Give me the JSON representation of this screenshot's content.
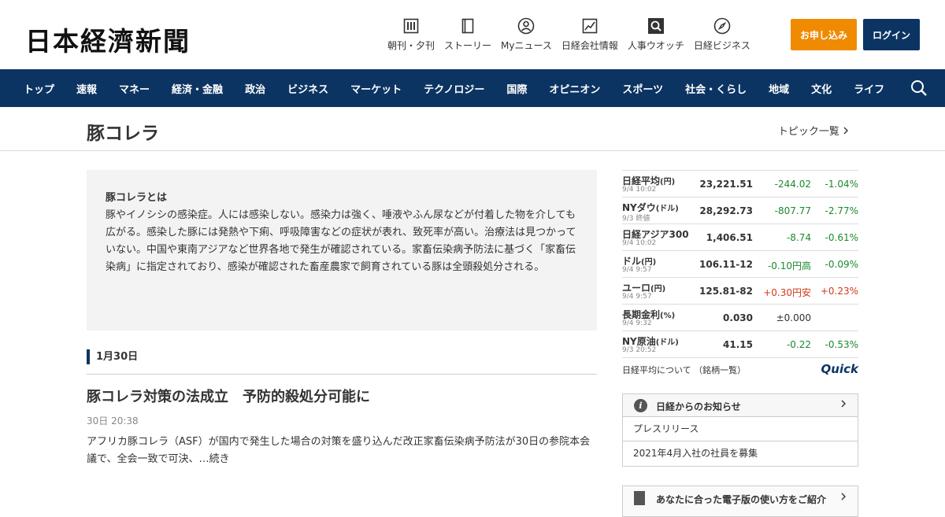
{
  "brand": {
    "logo_text": "日本経濟新聞",
    "apply_label": "お申し込み",
    "login_label": "ログイン"
  },
  "toolbar": [
    {
      "label": "朝刊・夕刊",
      "icon": "newspaper-icon"
    },
    {
      "label": "ストーリー",
      "icon": "book-icon"
    },
    {
      "label": "Myニュース",
      "icon": "user-icon"
    },
    {
      "label": "日経会社情報",
      "icon": "chart-icon"
    },
    {
      "label": "人事ウオッチ",
      "icon": "search-person-icon"
    },
    {
      "label": "日経ビジネス",
      "icon": "compass-icon"
    }
  ],
  "nav": [
    "トップ",
    "速報",
    "マネー",
    "経済・金融",
    "政治",
    "ビジネス",
    "マーケット",
    "テクノロジー",
    "国際",
    "オピニオン",
    "スポーツ",
    "社会・くらし",
    "地域",
    "文化",
    "ライフ"
  ],
  "topic": {
    "title": "豚コレラ",
    "list_link": "トピック一覧"
  },
  "description": {
    "heading": "豚コレラとは",
    "text": "豚やイノシシの感染症。人には感染しない。感染力は強く、唾液やふん尿などが付着した物を介しても広がる。感染した豚には発熱や下痢、呼吸障害などの症状が表れ、致死率が高い。治療法は見つかっていない。中国や東南アジアなど世界各地で発生が確認されている。家畜伝染病予防法に基づく「家畜伝染病」に指定されており、感染が確認された畜産農家で飼育されている豚は全頭殺処分される。"
  },
  "article_group": {
    "date": "1月30日",
    "articles": [
      {
        "title": "豚コレラ対策の法成立　予防的殺処分可能に",
        "time": "30日 20:38",
        "summary": "アフリカ豚コレラ（ASF）が国内で発生した場合の対策を盛り込んだ改正家畜伝染病予防法が30日の参院本会議で、全会一致で可決、…続き"
      }
    ]
  },
  "market": {
    "rows": [
      {
        "name": "日経平均",
        "unit": "(円)",
        "time": "9/4 10:02",
        "value": "23,221.51",
        "change": "-244.02",
        "pct": "-1.04%",
        "dir": "neg"
      },
      {
        "name": "NYダウ",
        "unit": "(ドル)",
        "time": "9/3 終値",
        "value": "28,292.73",
        "change": "-807.77",
        "pct": "-2.77%",
        "dir": "neg"
      },
      {
        "name": "日経アジア300",
        "unit": "",
        "time": "9/4 10:02",
        "value": "1,406.51",
        "change": "-8.74",
        "pct": "-0.61%",
        "dir": "neg"
      },
      {
        "name": "ドル",
        "unit": "(円)",
        "time": "9/4 9:57",
        "value": "106.11-12",
        "change": "-0.10円高",
        "pct": "-0.09%",
        "dir": "neg"
      },
      {
        "name": "ユーロ",
        "unit": "(円)",
        "time": "9/4 9:57",
        "value": "125.81-82",
        "change": "+0.30円安",
        "pct": "+0.23%",
        "dir": "pos"
      },
      {
        "name": "長期金利",
        "unit": "(%)",
        "time": "9/4 9:32",
        "value": "0.030",
        "change": "±0.000",
        "pct": "",
        "dir": "neu"
      },
      {
        "name": "NY原油",
        "unit": "(ドル)",
        "time": "9/3 20:52",
        "value": "41.15",
        "change": "-0.22",
        "pct": "-0.53%",
        "dir": "neg"
      }
    ],
    "about_label": "日経平均について （銘柄一覧）",
    "provider": "Quick"
  },
  "notice": {
    "heading": "日経からのお知らせ",
    "items": [
      "プレスリリース",
      "2021年4月入社の社員を募集"
    ]
  },
  "promo": {
    "label": "あなたに合った電子版の使い方をご紹介"
  },
  "colors": {
    "navy": "#0c3463",
    "orange": "#f08a00",
    "down": "#1a8a2e",
    "up": "#d03a1c"
  }
}
